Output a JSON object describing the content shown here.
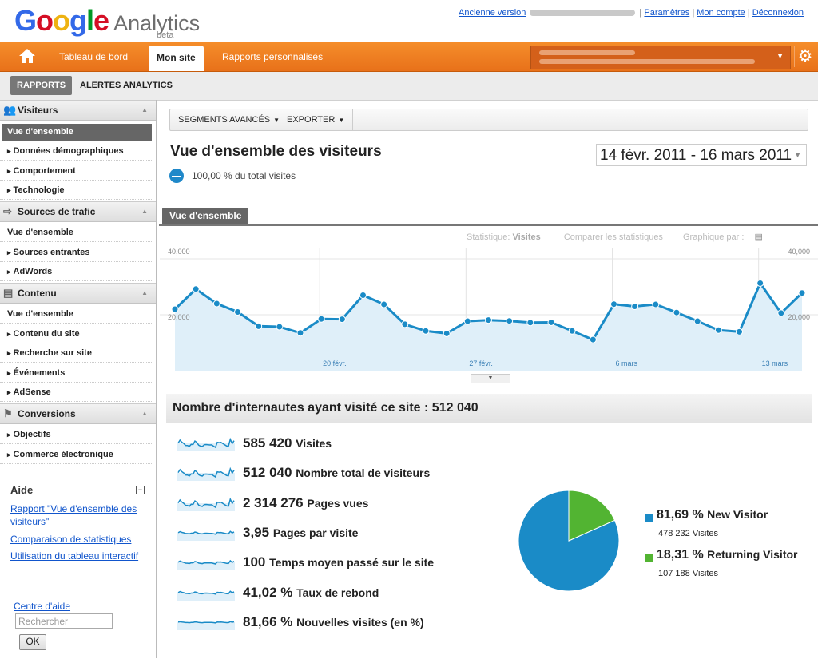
{
  "header": {
    "logo_google": "Google",
    "logo_product": "Analytics",
    "logo_beta": "beta",
    "links": {
      "old_version": "Ancienne version",
      "settings": "Paramètres",
      "account": "Mon compte",
      "logout": "Déconnexion"
    },
    "link_separator": "|"
  },
  "nav": {
    "home_icon": "home-icon",
    "tabs": [
      "Tableau de bord",
      "Mon site",
      "Rapports personnalisés"
    ],
    "active_tab": "Mon site",
    "gear_icon": "gear-icon"
  },
  "subnav": {
    "reports": "RAPPORTS",
    "alerts": "ALERTES ANALYTICS"
  },
  "sidebar": {
    "sections": [
      {
        "title": "Visiteurs",
        "icon": "visitors-icon",
        "items": [
          "Vue d'ensemble",
          "Données démographiques",
          "Comportement",
          "Technologie"
        ]
      },
      {
        "title": "Sources de trafic",
        "icon": "traffic-icon",
        "items": [
          "Vue d'ensemble",
          "Sources entrantes",
          "AdWords"
        ]
      },
      {
        "title": "Contenu",
        "icon": "content-icon",
        "items": [
          "Vue d'ensemble",
          "Contenu du site",
          "Recherche sur site",
          "Événements",
          "AdSense"
        ]
      },
      {
        "title": "Conversions",
        "icon": "conversions-icon",
        "items": [
          "Objectifs",
          "Commerce électronique"
        ]
      }
    ],
    "help": {
      "title": "Aide",
      "links": [
        "Rapport \"Vue d'ensemble des visiteurs\"",
        "Comparaison de statistiques",
        "Utilisation du tableau interactif"
      ],
      "help_center": "Centre d'aide",
      "search_placeholder": "Rechercher",
      "ok": "OK"
    }
  },
  "main": {
    "toolbar": {
      "segments": "SEGMENTS AVANCÉS",
      "export": "EXPORTER"
    },
    "title": "Vue d'ensemble des visiteurs",
    "date_range": "14 févr. 2011 - 16 mars 2011",
    "percent_total": "100,00 % du total visites",
    "tab": "Vue d'ensemble",
    "chart_options": {
      "stat_label": "Statistique:",
      "stat_value": "Visites",
      "compare": "Comparer les statistiques",
      "graph_by": "Graphique par :"
    },
    "summary": "Nombre d'internautes ayant visité ce site : 512 040",
    "metrics": [
      {
        "value": "585 420",
        "label": "Visites"
      },
      {
        "value": "512 040",
        "label": "Nombre total de visiteurs"
      },
      {
        "value": "2 314 276",
        "label": "Pages vues"
      },
      {
        "value": "3,95",
        "label": "Pages par visite"
      },
      {
        "value": "100",
        "label": "Temps moyen passé sur le site"
      },
      {
        "value": "41,02 %",
        "label": "Taux de rebond"
      },
      {
        "value": "81,66 %",
        "label": "Nouvelles visites (en %)"
      }
    ],
    "legend": [
      {
        "pct": "81,69 %",
        "name": "New Visitor",
        "count": "478 232 Visites",
        "color": "#1a8bc7"
      },
      {
        "pct": "18,31 %",
        "name": "Returning Visitor",
        "count": "107 188 Visites",
        "color": "#52b432"
      }
    ]
  },
  "chart_data": [
    {
      "type": "area",
      "ytick_labels": [
        "40,000",
        "20,000"
      ],
      "ylim": [
        0,
        40000
      ],
      "xtick_labels": [
        "20 févr.",
        "27 févr.",
        "6 mars",
        "13 mars"
      ],
      "color": "#1a8bc7",
      "series": [
        {
          "values": [
            22000,
            29200,
            24000,
            21000,
            15900,
            15700,
            13500,
            18500,
            18400,
            27000,
            23700,
            16600,
            14200,
            13300,
            17700,
            18100,
            17800,
            17200,
            17300,
            14200,
            11100,
            23800,
            23000,
            23700,
            20800,
            17700,
            14500,
            13900,
            31300,
            20600,
            27800
          ]
        }
      ]
    },
    {
      "type": "pie",
      "categories": [
        "New Visitor",
        "Returning Visitor"
      ],
      "values": [
        81.69,
        18.31
      ],
      "colors": [
        "#1a8bc7",
        "#52b432"
      ]
    }
  ]
}
